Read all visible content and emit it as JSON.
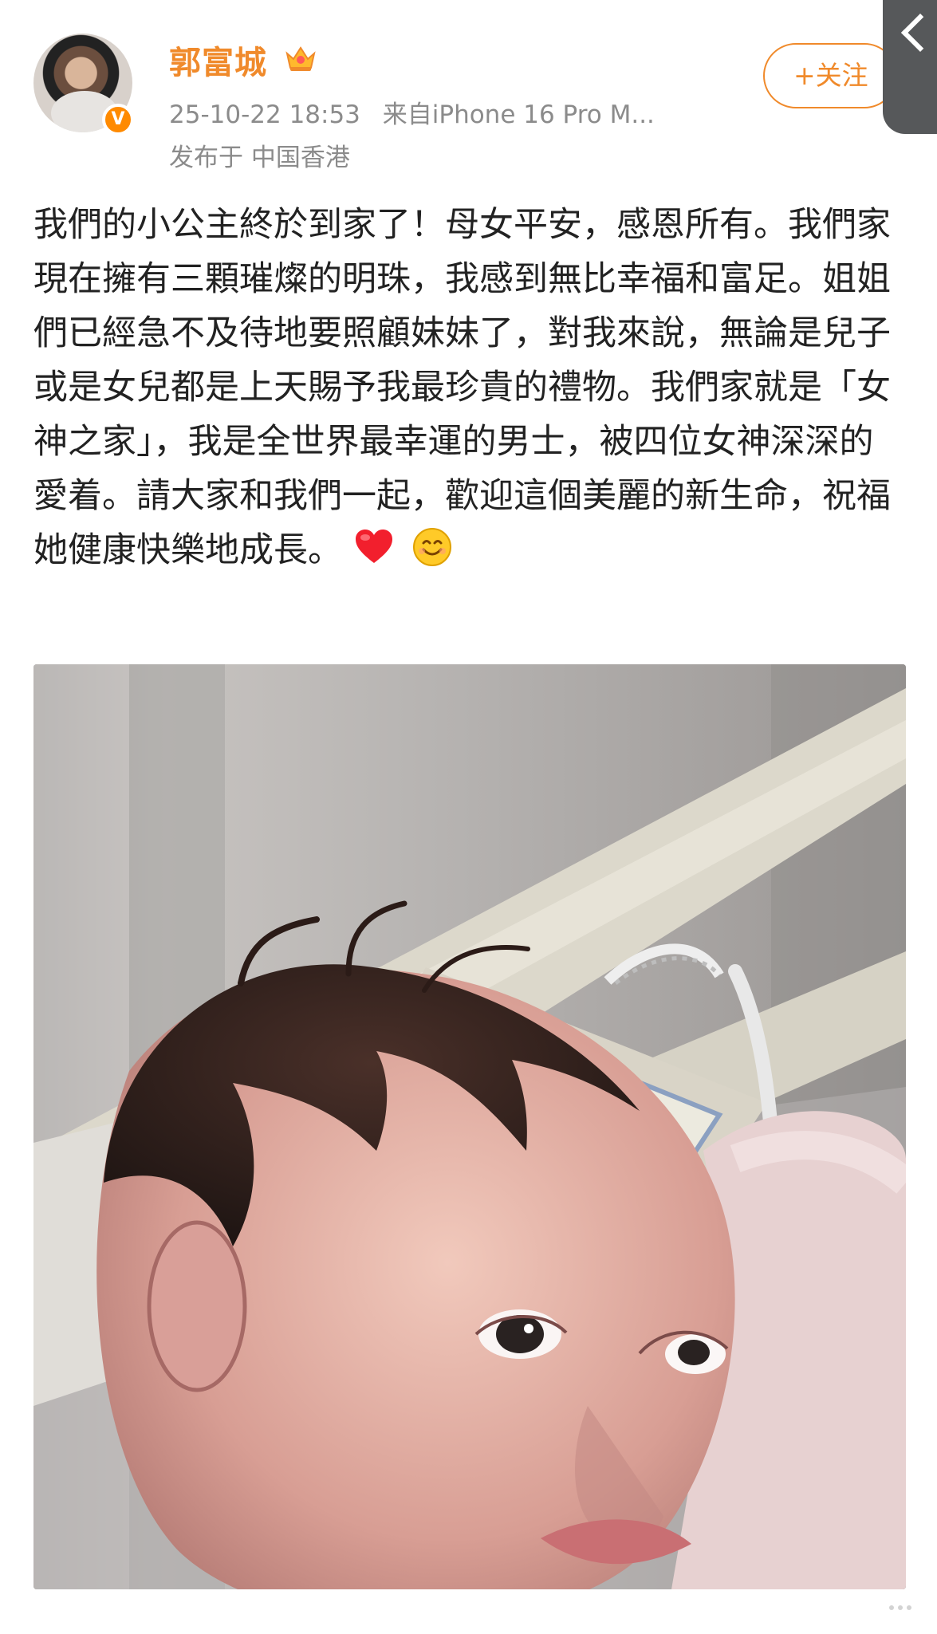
{
  "user": {
    "name": "郭富城",
    "timestamp": "25-10-22 18:53",
    "source": "来自iPhone 16 Pro M...",
    "location": "发布于 中国香港",
    "follow_label": "+关注",
    "verified": true
  },
  "post": {
    "text": "我們的小公主終於到家了！母女平安，感恩所有。我們家現在擁有三顆璀燦的明珠，我感到無比幸福和富足。姐姐們已經急不及待地要照顧妹妹了，對我來說，無論是兒子或是女兒都是上天賜予我最珍貴的禮物。我們家就是「女神之家」，我是全世界最幸運的男士，被四位女神深深的愛着。請大家和我們一起，歡迎這個美麗的新生命，祝福她健康快樂地成長。",
    "emojis": [
      "heart-emoji",
      "smile-emoji"
    ]
  },
  "image": {
    "subject": "newborn-baby-photo"
  },
  "colors": {
    "accent": "#f08a2b",
    "meta": "#8b8b8b",
    "background": "#ffffff"
  }
}
